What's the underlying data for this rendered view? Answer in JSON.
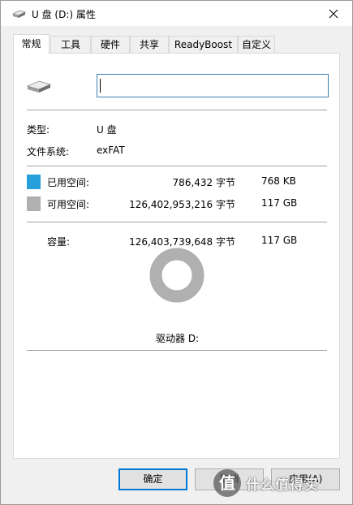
{
  "window": {
    "title": "U 盘 (D:) 属性"
  },
  "tabs": [
    {
      "label": "常规",
      "active": true
    },
    {
      "label": "工具",
      "active": false
    },
    {
      "label": "硬件",
      "active": false
    },
    {
      "label": "共享",
      "active": false
    },
    {
      "label": "ReadyBoost",
      "active": false
    },
    {
      "label": "自定义",
      "active": false
    }
  ],
  "general": {
    "name_value": "",
    "type_label": "类型:",
    "type_value": "U 盘",
    "fs_label": "文件系统:",
    "fs_value": "exFAT",
    "used": {
      "label": "已用空间:",
      "bytes": "786,432 字节",
      "size": "768 KB",
      "color": "#26a0da"
    },
    "free": {
      "label": "可用空间:",
      "bytes": "126,402,953,216 字节",
      "size": "117 GB",
      "color": "#b0b0b0"
    },
    "capacity": {
      "label": "容量:",
      "bytes": "126,403,739,648 字节",
      "size": "117 GB"
    },
    "drive_label": "驱动器 D:",
    "used_fraction": 6.2e-06
  },
  "buttons": {
    "ok": "确定",
    "cancel": "取消",
    "apply": "应用(A)"
  },
  "watermark": {
    "glyph": "值",
    "text": "什么值得买"
  }
}
